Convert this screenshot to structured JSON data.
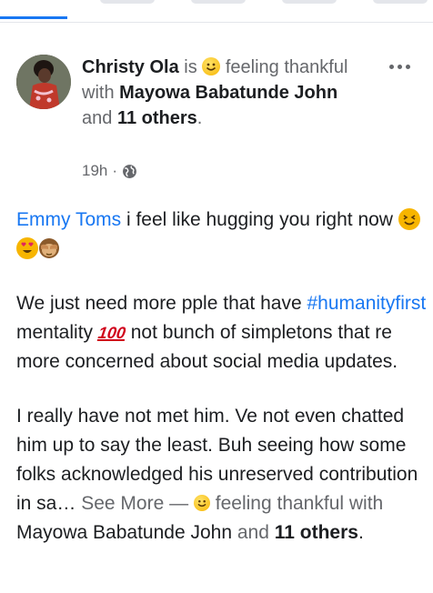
{
  "colors": {
    "accent": "#1877f2",
    "text": "#1c1e21",
    "muted": "#65676b"
  },
  "post": {
    "author": "Christy Ola",
    "is_text": "is",
    "feeling_icon": "smiling-face-emoji",
    "activity_text": "feeling thankful with",
    "tagged_first": "Mayowa Babatunde John",
    "and_text": "and",
    "tagged_others": "11 others",
    "period": ".",
    "time": "19h",
    "separator": "·",
    "privacy_icon": "globe-icon",
    "more_icon": "more-options-icon"
  },
  "body": {
    "mention": "Emmy Toms",
    "line1_text": " i feel like hugging you right now ",
    "p2_start": "We just need more pple that have ",
    "hashtag": "#humanityfirst",
    "p2_mid": " mentality ",
    "hundred_emoji": "100",
    "p2_end": " not bunch of simpletons that re more concerned about social media updates.",
    "p3_text": "I really have not met him. Ve not even chatted him up to say the least. Buh seeing how some folks acknowledged his unreserved contribution in sa… ",
    "see_more": "See More",
    "dash": "—",
    "footer_activity": " feeling thankful with ",
    "footer_tagged_first": "Mayowa Babatunde John",
    "footer_and": " and ",
    "footer_tagged_others": "11 others",
    "footer_period": "."
  }
}
